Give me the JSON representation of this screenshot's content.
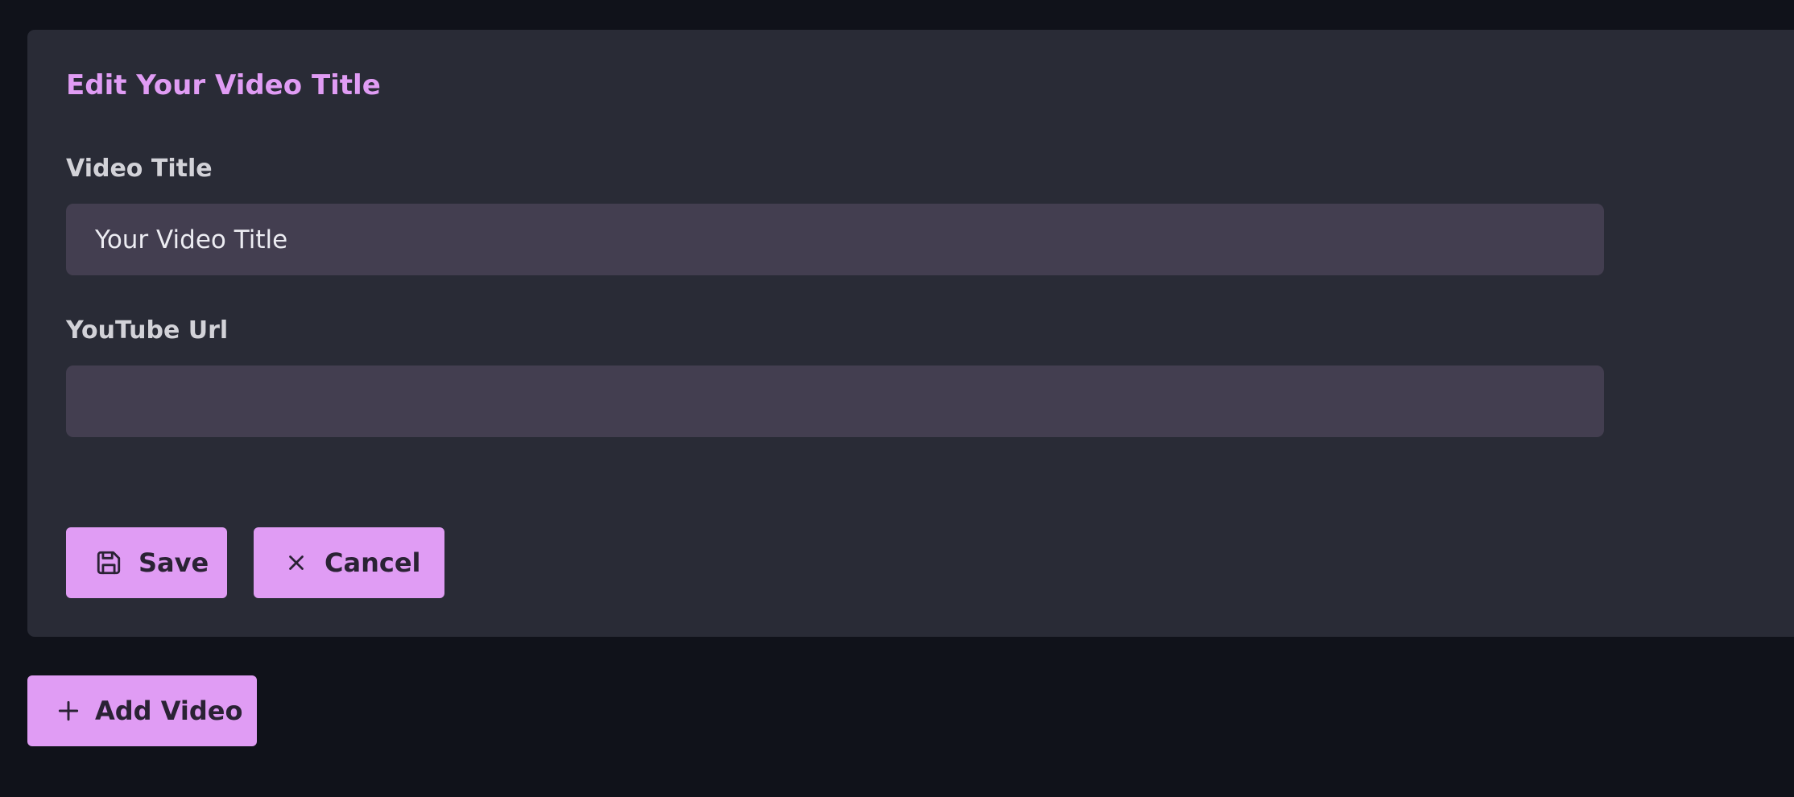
{
  "form": {
    "title": "Edit Your Video Title",
    "video_title_label": "Video Title",
    "video_title_value": "Your Video Title",
    "youtube_url_label": "YouTube Url",
    "youtube_url_value": "",
    "save_label": "Save",
    "cancel_label": "Cancel"
  },
  "actions": {
    "add_video_label": "Add Video"
  },
  "icons": {
    "save": "floppy-disk-icon",
    "cancel": "close-icon",
    "add": "plus-icon"
  },
  "colors": {
    "accent": "#e09cf4",
    "background": "#10121a",
    "panel": "#292b36",
    "input": "#433e50"
  }
}
